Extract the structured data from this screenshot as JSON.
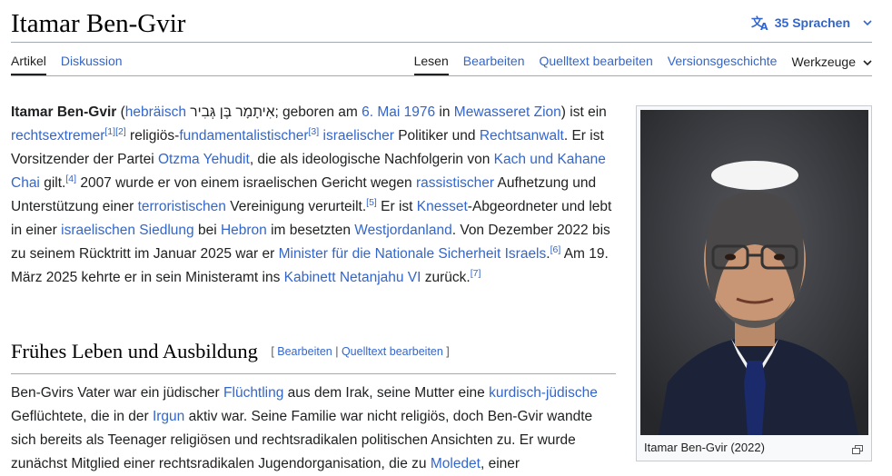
{
  "header": {
    "title": "Itamar Ben-Gvir",
    "languages_label": "35 Sprachen"
  },
  "tabs": {
    "left": [
      "Artikel",
      "Diskussion"
    ],
    "right": [
      "Lesen",
      "Bearbeiten",
      "Quelltext bearbeiten",
      "Versionsgeschichte"
    ],
    "tools": "Werkzeuge"
  },
  "intro": {
    "name": "Itamar Ben-Gvir",
    "lang": "hebräisch",
    "hebrew": "אִיתָמָר בֶּן גְּבִיר",
    "t1": "; geboren am ",
    "date": "6. Mai 1976",
    "t2": " in ",
    "place": "Mewasseret Zion",
    "t3": ") ist ein ",
    "rechtsextremer": "rechtsextremer",
    "r1": "[1]",
    "r2": "[2]",
    "t4": " religiös-",
    "fund": "fundamentalistischer",
    "r3": "[3]",
    "isr": "israelischer",
    "t5": " Politiker und ",
    "anwalt": "Rechtsanwalt",
    "t6": ". Er ist Vorsitzender der Partei ",
    "otzma": "Otzma Yehudit",
    "t7": ", die als ideologische Nachfolgerin von ",
    "kach": "Kach und Kahane Chai",
    "t8": " gilt.",
    "r4": "[4]",
    "t9": " 2007 wurde er von einem israelischen Gericht wegen ",
    "rass": "rassistischer",
    "t10": " Aufhetzung und Unterstützung einer ",
    "terr": "terroristischen",
    "t11": " Vereinigung verurteilt.",
    "r5": "[5]",
    "t12": " Er ist ",
    "knesset": "Knesset",
    "t13": "-Abgeordneter und lebt in einer ",
    "siedlung": "israelischen Siedlung",
    "t14": " bei ",
    "hebron": "Hebron",
    "t15": " im besetzten ",
    "west": "Westjordanland",
    "t16": ". Von Dezember 2022 bis zu seinem Rücktritt im Januar 2025 war er ",
    "minister": "Minister für die Nationale Sicherheit Israels",
    "t17": ".",
    "r6": "[6]",
    "t18": " Am 19. März 2025 kehrte er in sein Ministeramt ins ",
    "kabinett": "Kabinett Netanjahu VI",
    "t19": " zurück.",
    "r7": "[7]"
  },
  "section": {
    "heading": "Frühes Leben und Ausbildung",
    "edit_open": "[ ",
    "edit": "Bearbeiten",
    "sep": " | ",
    "source": "Quelltext bearbeiten",
    "edit_close": " ]",
    "s1": "Ben-Gvirs Vater war ein jüdischer ",
    "fluechtling": "Flüchtling",
    "s2": " aus dem Irak, seine Mutter eine ",
    "kurd": "kurdisch-jüdische",
    "s3": " Geflüchtete, die in der ",
    "irgun": "Irgun",
    "s4": " aktiv war. Seine Familie war nicht religiös, doch Ben-Gvir wandte sich bereits als Teenager religiösen und rechtsradikalen politischen Ansichten zu. Er wurde zunächst Mitglied einer rechtsradikalen Jugendorganisation, die zu ",
    "moledet": "Moledet",
    "s5": ", einer"
  },
  "infobox": {
    "caption": "Itamar Ben-Gvir (2022)"
  }
}
